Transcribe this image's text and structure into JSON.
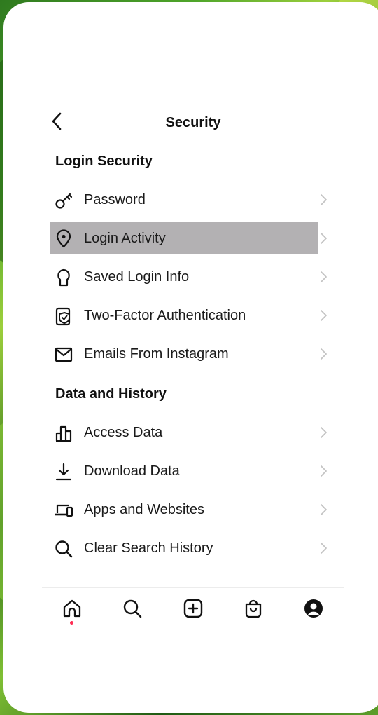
{
  "header": {
    "title": "Security"
  },
  "sections": [
    {
      "title": "Login Security",
      "items": [
        {
          "label": "Password",
          "icon": "key-icon"
        },
        {
          "label": "Login Activity",
          "icon": "location-pin-icon"
        },
        {
          "label": "Saved Login Info",
          "icon": "keyhole-icon"
        },
        {
          "label": "Two-Factor Authentication",
          "icon": "shield-phone-icon"
        },
        {
          "label": "Emails From Instagram",
          "icon": "envelope-icon"
        }
      ]
    },
    {
      "title": "Data and History",
      "items": [
        {
          "label": "Access Data",
          "icon": "bar-chart-icon"
        },
        {
          "label": "Download Data",
          "icon": "download-icon"
        },
        {
          "label": "Apps and Websites",
          "icon": "devices-icon"
        },
        {
          "label": "Clear Search History",
          "icon": "search-icon"
        }
      ]
    }
  ],
  "tabbar": [
    "home-icon",
    "search-icon",
    "add-post-icon",
    "shop-bag-icon",
    "profile-icon"
  ],
  "colors": {
    "highlight": "#b3b1b3",
    "notification_dot": "#ff2e55"
  }
}
